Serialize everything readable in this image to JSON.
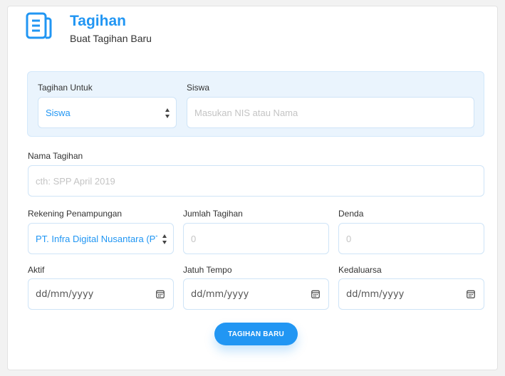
{
  "header": {
    "title": "Tagihan",
    "subtitle": "Buat Tagihan Baru",
    "icon": "document-icon",
    "accent_color": "#2196f3"
  },
  "form": {
    "tagihan_untuk": {
      "label": "Tagihan Untuk",
      "value": "Siswa"
    },
    "siswa": {
      "label": "Siswa",
      "placeholder": "Masukan NIS atau Nama"
    },
    "nama_tagihan": {
      "label": "Nama Tagihan",
      "placeholder": "cth: SPP April 2019"
    },
    "rekening": {
      "label": "Rekening Penampungan",
      "value": "PT. Infra Digital Nusantara (PT."
    },
    "jumlah": {
      "label": "Jumlah Tagihan",
      "placeholder": "0"
    },
    "denda": {
      "label": "Denda",
      "placeholder": "0"
    },
    "aktif": {
      "label": "Aktif",
      "value": "dd/mm/yyyy"
    },
    "jatuh_tempo": {
      "label": "Jatuh Tempo",
      "value": "dd/mm/yyyy"
    },
    "kedaluarsa": {
      "label": "Kedaluarsa",
      "value": "dd/mm/yyyy"
    },
    "submit_label": "TAGIHAN BARU"
  }
}
